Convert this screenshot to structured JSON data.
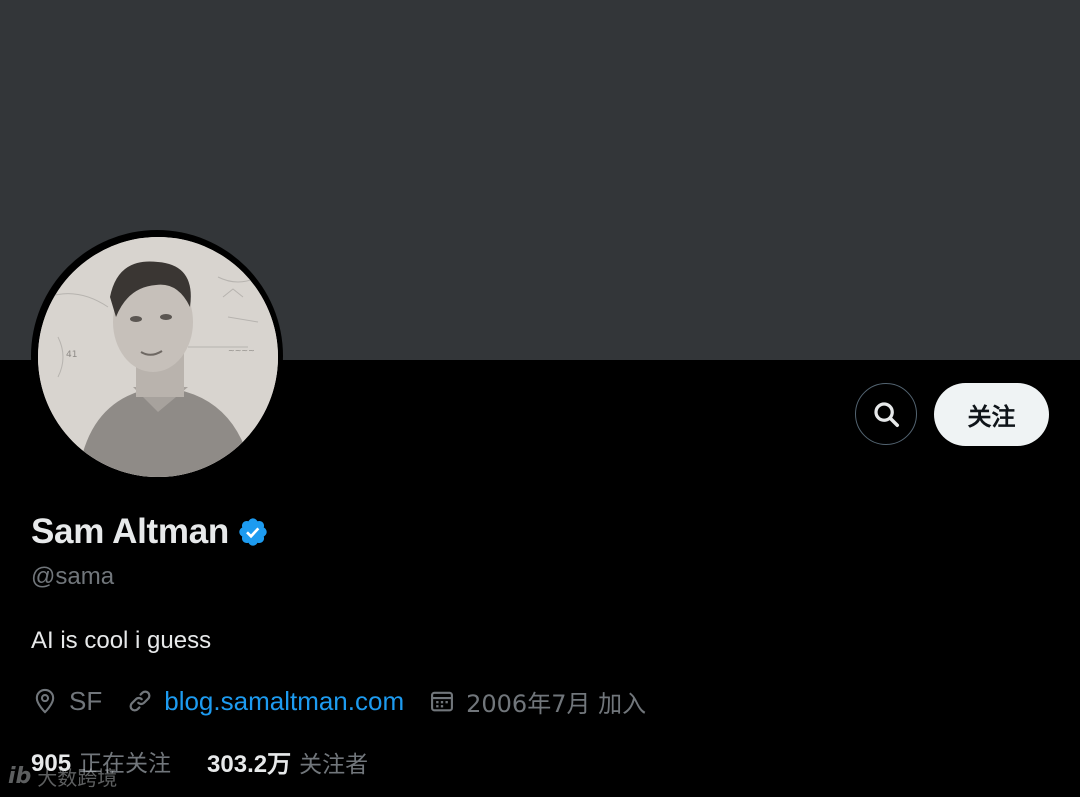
{
  "profile": {
    "display_name": "Sam Altman",
    "handle": "@sama",
    "bio": "AI is cool i guess",
    "location": "SF",
    "website": "blog.samaltman.com",
    "joined": "2006年7月 加入",
    "verified_icon": "verified-badge-icon"
  },
  "actions": {
    "search_icon": "search-icon",
    "follow_label": "关注"
  },
  "stats": {
    "following_count": "905",
    "following_label": "正在关注",
    "followers_count": "303.2万",
    "followers_label": "关注者"
  },
  "icons": {
    "location": "location-pin-icon",
    "link": "link-icon",
    "calendar": "calendar-icon"
  },
  "colors": {
    "background": "#000000",
    "banner": "#333639",
    "accent": "#1d9bf0",
    "text_primary": "#e7e9ea",
    "text_secondary": "#71767b",
    "follow_button_bg": "#eff3f4"
  },
  "watermark": {
    "logo": "ib",
    "text": "大数跨境"
  }
}
